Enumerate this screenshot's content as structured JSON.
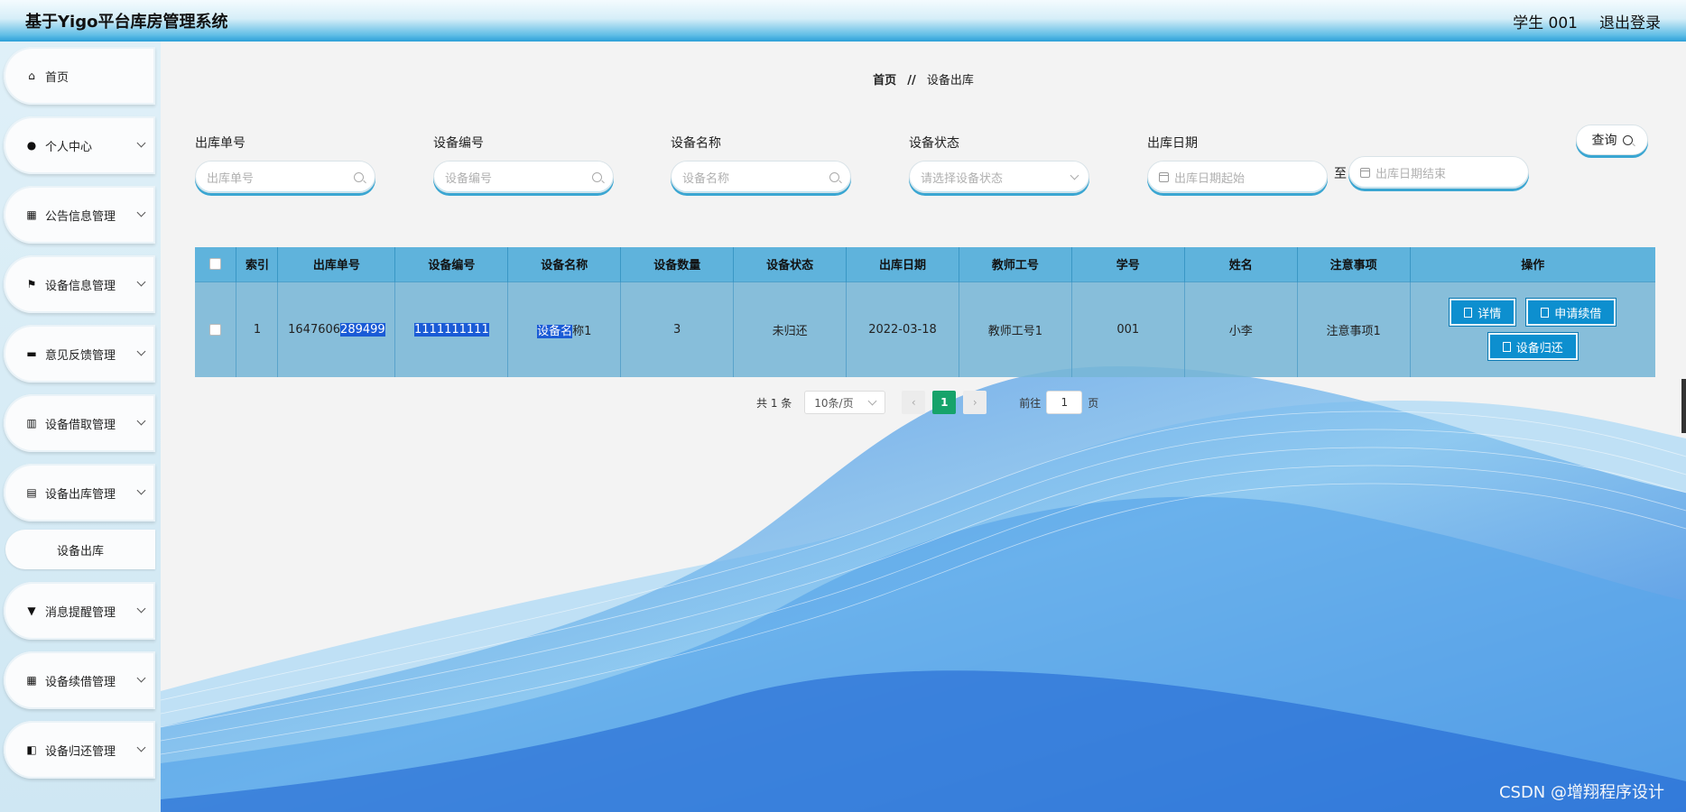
{
  "header": {
    "title": "基于Yigo平台库房管理系统",
    "user": "学生 001",
    "logout": "退出登录"
  },
  "sidebar": {
    "items": [
      {
        "label": "首页",
        "icon": "home-icon",
        "glyph": "⌂"
      },
      {
        "label": "个人中心",
        "icon": "user-icon",
        "glyph": "●"
      },
      {
        "label": "公告信息管理",
        "icon": "grid-icon",
        "glyph": "▦"
      },
      {
        "label": "设备信息管理",
        "icon": "flag-icon",
        "glyph": "⚑"
      },
      {
        "label": "意见反馈管理",
        "icon": "comment-icon",
        "glyph": "▬"
      },
      {
        "label": "设备借取管理",
        "icon": "bar-chart-icon",
        "glyph": "▥"
      },
      {
        "label": "设备出库管理",
        "icon": "clipboard-icon",
        "glyph": "▤"
      },
      {
        "label": "消息提醒管理",
        "icon": "bell-icon",
        "glyph": "▼"
      },
      {
        "label": "设备续借管理",
        "icon": "grid-icon",
        "glyph": "▦"
      },
      {
        "label": "设备归还管理",
        "icon": "return-icon",
        "glyph": "◧"
      }
    ],
    "sub_item": "设备出库"
  },
  "breadcrumb": {
    "home": "首页",
    "sep": "//",
    "current": "设备出库"
  },
  "filters": {
    "f1": {
      "label": "出库单号",
      "placeholder": "出库单号"
    },
    "f2": {
      "label": "设备编号",
      "placeholder": "设备编号"
    },
    "f3": {
      "label": "设备名称",
      "placeholder": "设备名称"
    },
    "f4": {
      "label": "设备状态",
      "placeholder": "请选择设备状态"
    },
    "f5": {
      "label": "出库日期",
      "start_placeholder": "出库日期起始",
      "to": "至",
      "end_placeholder": "出库日期结束"
    },
    "query": "查询"
  },
  "table": {
    "headers": [
      "索引",
      "出库单号",
      "设备编号",
      "设备名称",
      "设备数量",
      "设备状态",
      "出库日期",
      "教师工号",
      "学号",
      "姓名",
      "注意事项",
      "操作"
    ],
    "row": {
      "index": "1",
      "order_a": "1647606",
      "order_b": "289499",
      "device_no": "1111111111",
      "name_a": "设备名",
      "name_b": "称1",
      "qty": "3",
      "status": "未归还",
      "date": "2022-03-18",
      "teacher": "教师工号1",
      "student": "001",
      "person": "小李",
      "notes": "注意事项1",
      "btn_detail": "详情",
      "btn_renew": "申请续借",
      "btn_return": "设备归还"
    }
  },
  "pager": {
    "total": "共 1 条",
    "size": "10条/页",
    "prev": "‹",
    "current": "1",
    "next": "›",
    "goto": "前往",
    "page_value": "1",
    "page_unit": "页"
  },
  "watermark": "CSDN @增翔程序设计",
  "colors": {
    "accent": "#0d8fcf",
    "header_cell": "#5fb3dc",
    "page_active": "#16a36a"
  }
}
